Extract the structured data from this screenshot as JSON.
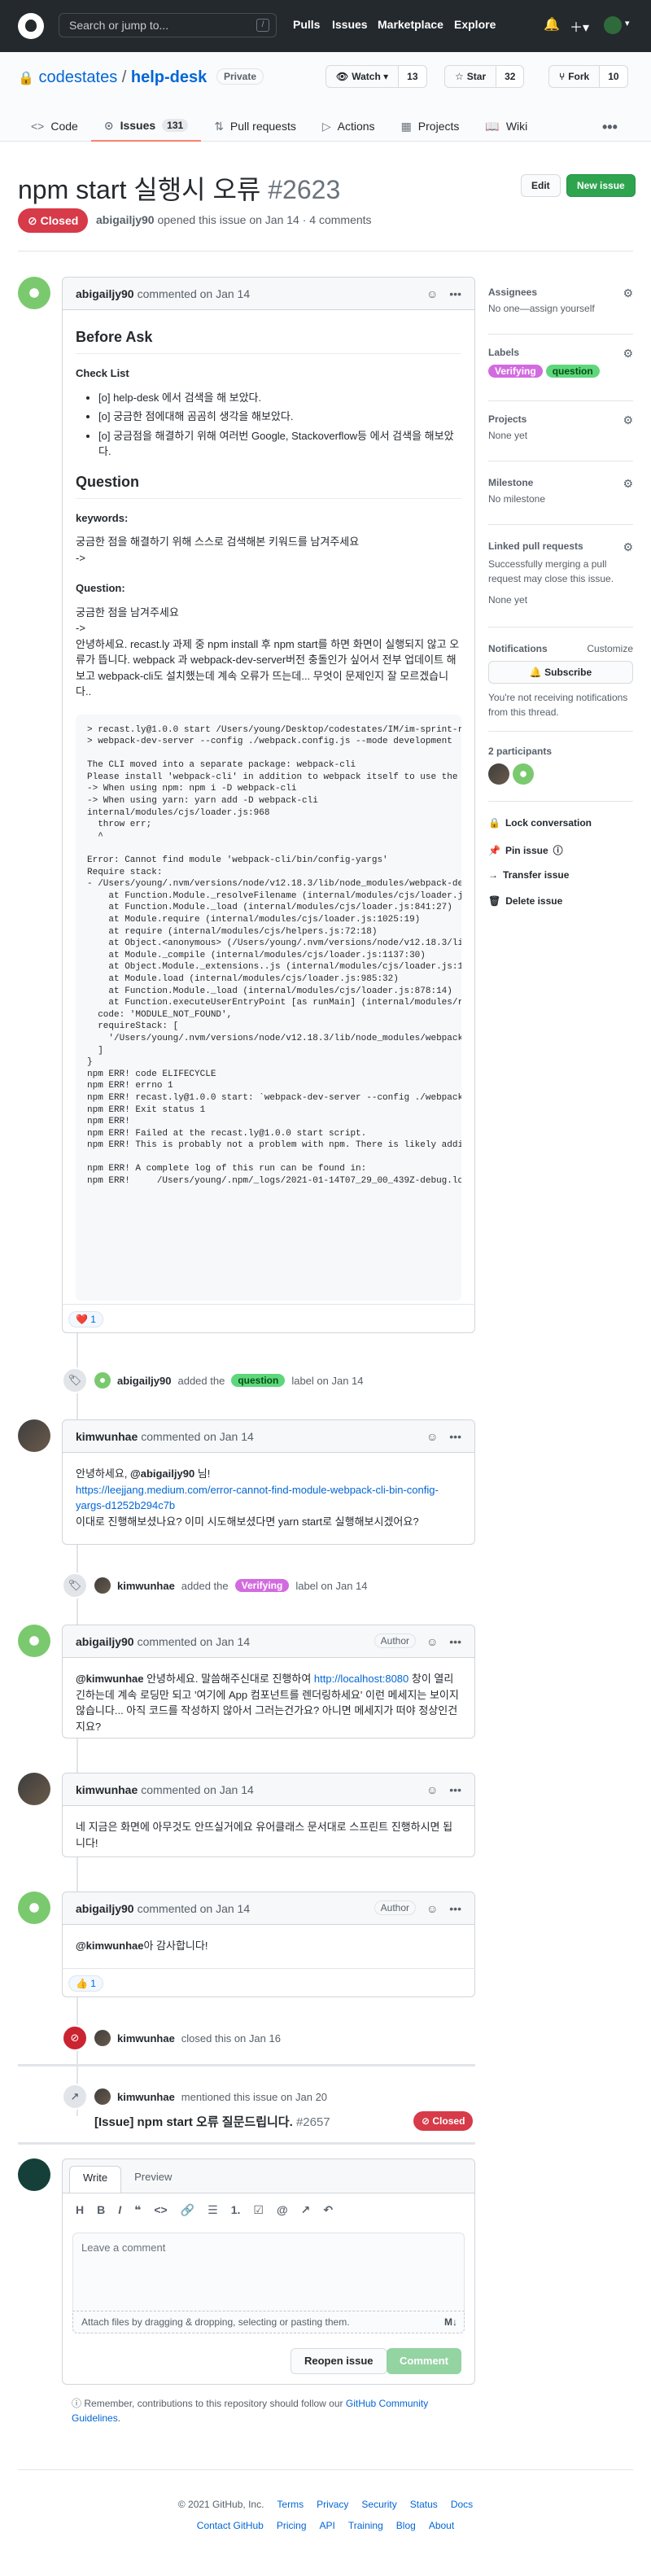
{
  "header": {
    "search_placeholder": "Search or jump to...",
    "slash_key": "/",
    "nav": [
      "Pulls",
      "Issues",
      "Marketplace",
      "Explore"
    ]
  },
  "repo": {
    "owner": "codestates",
    "name": "help-desk",
    "separator": "/",
    "visibility": "Private",
    "watch_label": "Watch",
    "watch_count": "13",
    "star_label": "Star",
    "star_count": "32",
    "fork_label": "Fork",
    "fork_count": "10"
  },
  "tabs": [
    {
      "label": "Code",
      "icon": "<>"
    },
    {
      "label": "Issues",
      "icon": "⊙",
      "count": "131"
    },
    {
      "label": "Pull requests",
      "icon": "⇅"
    },
    {
      "label": "Actions",
      "icon": "▷"
    },
    {
      "label": "Projects",
      "icon": "▦"
    },
    {
      "label": "Wiki",
      "icon": "📖"
    }
  ],
  "issue": {
    "title": "npm start 실행시 오류",
    "number": "#2623",
    "state": "Closed",
    "author": "abigailjy90",
    "meta": "opened this issue on Jan 14 · 4 comments",
    "edit_label": "Edit",
    "new_issue_label": "New issue"
  },
  "first_comment": {
    "author": "abigailjy90",
    "meta": "commented on Jan 14",
    "h_before": "Before Ask",
    "h_checklist": "Check List",
    "checklist": [
      "[o] help-desk 에서 검색을 해 보았다.",
      "[o] 궁금한 점에대해 곰곰히 생각을 해보았다.",
      "[o] 궁금점을 해결하기 위해 여러번 Google, Stackoverflow등 에서 검색을 해보았다."
    ],
    "h_question": "Question",
    "h_keywords": "keywords:",
    "keywords_text": "궁금한 점을 해결하기 위해 스스로 검색해본 키워드를 남겨주세요",
    "keywords_arrow": "->",
    "h_question2": "Question:",
    "question_text": "궁금한 점을 남겨주세요",
    "question_arrow": "->",
    "question_body": "안녕하세요. recast.ly 과제 중 npm install 후 npm start를 하면 화면이 실행되지 않고 오류가 뜹니다. webpack 과 webpack-dev-server버전 충돌인가 싶어서 전부 업데이트 해보고 webpack-cli도 설치했는데 계속 오류가 뜨는데... 무엇이 문제인지 잘 모르겠습니다..",
    "code": "> recast.ly@1.0.0 start /Users/young/Desktop/codestates/IM/im-sprint-recast.ly\n> webpack-dev-server --config ./webpack.config.js --mode development\n\nThe CLI moved into a separate package: webpack-cli\nPlease install 'webpack-cli' in addition to webpack itself to use the CLI\n-> When using npm: npm i -D webpack-cli\n-> When using yarn: yarn add -D webpack-cli\ninternal/modules/cjs/loader.js:968\n  throw err;\n  ^\n\nError: Cannot find module 'webpack-cli/bin/config-yargs'\nRequire stack:\n- /Users/young/.nvm/versions/node/v12.18.3/lib/node_modules/webpack-dev-server/bin/webpack-dev-server.js\n    at Function.Module._resolveFilename (internal/modules/cjs/loader.js:965:15)\n    at Function.Module._load (internal/modules/cjs/loader.js:841:27)\n    at Module.require (internal/modules/cjs/loader.js:1025:19)\n    at require (internal/modules/cjs/helpers.js:72:18)\n    at Object.<anonymous> (/Users/young/.nvm/versions/node/v12.18.3/lib/node_modules/webpack-dev-server/bin/webpack-dev-server.js:65:1)\n    at Module._compile (internal/modules/cjs/loader.js:1137:30)\n    at Object.Module._extensions..js (internal/modules/cjs/loader.js:1157:10)\n    at Module.load (internal/modules/cjs/loader.js:985:32)\n    at Function.Module._load (internal/modules/cjs/loader.js:878:14)\n    at Function.executeUserEntryPoint [as runMain] (internal/modules/run_main.js:71:12) {\n  code: 'MODULE_NOT_FOUND',\n  requireStack: [\n    '/Users/young/.nvm/versions/node/v12.18.3/lib/node_modules/webpack-dev-server/bin/webpack-dev-server.js'\n  ]\n}\nnpm ERR! code ELIFECYCLE\nnpm ERR! errno 1\nnpm ERR! recast.ly@1.0.0 start: `webpack-dev-server --config ./webpack.config.js --mode development`\nnpm ERR! Exit status 1\nnpm ERR!\nnpm ERR! Failed at the recast.ly@1.0.0 start script.\nnpm ERR! This is probably not a problem with npm. There is likely additional logging output above.\n\nnpm ERR! A complete log of this run can be found in:\nnpm ERR!     /Users/young/.npm/_logs/2021-01-14T07_29_00_439Z-debug.log",
    "reaction_emoji": "❤️",
    "reaction_count": "1"
  },
  "events": {
    "label_question": {
      "actor": "abigailjy90",
      "text_before": "added the",
      "label": "question",
      "text_after": "label on Jan 14"
    },
    "label_verifying": {
      "actor": "kimwunhae",
      "text_before": "added the",
      "label": "Verifying",
      "text_after": "label on Jan 14"
    },
    "closed": {
      "actor": "kimwunhae",
      "text": "closed this on Jan 16"
    },
    "mentioned": {
      "actor": "kimwunhae",
      "text": "mentioned this issue on Jan 20"
    }
  },
  "comment2": {
    "author": "kimwunhae",
    "meta": "commented on Jan 14",
    "line1_a": "안녕하세요, ",
    "line1_mention": "@abigailjy90",
    "line1_b": " 님!",
    "link": "https://leejjang.medium.com/error-cannot-find-module-webpack-cli-bin-config-yargs-d1252b294c7b",
    "line3": "이대로 진행해보셨나요? 이미 시도해보셨다면 yarn start로 실행해보시겠어요?"
  },
  "comment3": {
    "author": "abigailjy90",
    "meta": "commented on Jan 14",
    "badge": "Author",
    "mention": "@kimwunhae",
    "text_a": " 안녕하세요. 말씀해주신대로 진행하여 ",
    "link": "http://localhost:8080",
    "text_b": " 창이 열리긴하는데 계속 로딩만 되고 '여기에 App 컴포넌트를 렌더링하세요' 이런 메세지는 보이지 않습니다... 아직 코드를 작성하지 않아서 그러는건가요? 아니면 메세지가 떠야 정상인건지요?"
  },
  "comment4": {
    "author": "kimwunhae",
    "meta": "commented on Jan 14",
    "text": "네 지금은 화면에 아무것도 안뜨실거에요 유어클래스 문서대로 스프린트 진행하시면 됩니다!"
  },
  "comment5": {
    "author": "abigailjy90",
    "meta": "commented on Jan 14",
    "badge": "Author",
    "mention": "@kimwunhae",
    "text": "아 감사합니다!",
    "reaction_emoji": "👍",
    "reaction_count": "1"
  },
  "reference": {
    "title": "[Issue] npm start 오류 질문드립니다.",
    "number": "#2657",
    "state": "Closed"
  },
  "new_comment": {
    "tab_write": "Write",
    "tab_preview": "Preview",
    "toolbar": [
      "H",
      "B",
      "I",
      "❝",
      "<>",
      "🔗",
      "☰",
      "1.",
      "☑",
      "@",
      "↗",
      "↶"
    ],
    "placeholder": "Leave a comment",
    "attach": "Attach files by dragging & dropping, selecting or pasting them.",
    "md_badge": "M↓",
    "reopen": "Reopen issue",
    "submit": "Comment"
  },
  "guideline": {
    "text": "Remember, contributions to this repository should follow our ",
    "link": "GitHub Community Guidelines",
    "end": "."
  },
  "sidebar": {
    "assignees_title": "Assignees",
    "assignees_value": "No one—assign yourself",
    "labels_title": "Labels",
    "labels": [
      "Verifying",
      "question"
    ],
    "projects_title": "Projects",
    "projects_value": "None yet",
    "milestone_title": "Milestone",
    "milestone_value": "No milestone",
    "linked_title": "Linked pull requests",
    "linked_desc": "Successfully merging a pull request may close this issue.",
    "linked_value": "None yet",
    "notif_title": "Notifications",
    "notif_customize": "Customize",
    "subscribe": "Subscribe",
    "notif_desc": "You're not receiving notifications from this thread.",
    "participants": "2 participants",
    "actions": [
      "Lock conversation",
      "Pin issue",
      "Transfer issue",
      "Delete issue"
    ]
  },
  "footer": {
    "copyright": "© 2021 GitHub, Inc.",
    "row1": [
      "Terms",
      "Privacy",
      "Security",
      "Status",
      "Docs"
    ],
    "row2": [
      "Contact GitHub",
      "Pricing",
      "API",
      "Training",
      "Blog",
      "About"
    ]
  }
}
